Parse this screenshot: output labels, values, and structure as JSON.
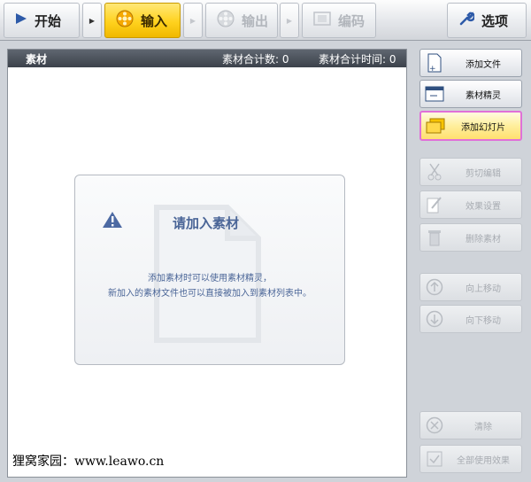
{
  "toolbar": {
    "start_label": "开始",
    "input_label": "输入",
    "output_label": "输出",
    "encode_label": "编码",
    "options_label": "选项"
  },
  "materials": {
    "header_label": "素材",
    "count_label": "素材合计数: 0",
    "time_label": "素材合计时间: 0",
    "empty_title": "请加入素材",
    "empty_line1": "添加素材时可以使用素材精灵，",
    "empty_line2": "新加入的素材文件也可以直接被加入到素材列表中。"
  },
  "sidebar": {
    "add_file": "添加文件",
    "wizard": "素材精灵",
    "add_slideshow": "添加幻灯片",
    "cut_edit": "剪切编辑",
    "effects": "效果设置",
    "delete": "删除素材",
    "move_up": "向上移动",
    "move_down": "向下移动",
    "clear": "清除",
    "apply_all": "全部使用效果"
  },
  "watermark": "狸窝家园：www.leawo.cn",
  "colors": {
    "accent_yellow": "#ffd21e",
    "highlight_border": "#e070d8",
    "header_dark": "#3c424b",
    "empty_text": "#4a6597"
  }
}
